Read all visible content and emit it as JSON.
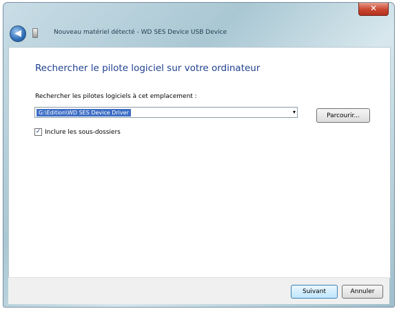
{
  "titlebar": {
    "close_label": "✕",
    "title": "Nouveau matériel détecté - WD SES Device USB Device"
  },
  "header": {
    "back_label": "◀"
  },
  "content": {
    "heading": "Rechercher le pilote logiciel sur votre ordinateur",
    "location_label": "Rechercher les pilotes logiciels à cet emplacement :",
    "path_value": "G:\\Edition\\WD SES Device Driver",
    "dropdown_arrow": "▾",
    "browse_label": "Parcourir...",
    "include_subfolders": {
      "checked_mark": "✓",
      "label": "Inclure les sous-dossiers"
    }
  },
  "footer": {
    "next_label": "Suivant",
    "cancel_label": "Annuler"
  }
}
